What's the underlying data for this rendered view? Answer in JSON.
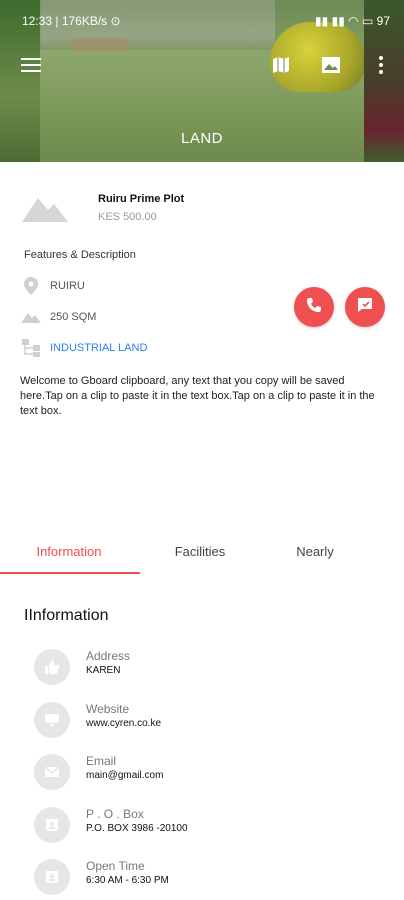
{
  "status_bar": {
    "time": "12:33 | 176KB/s ⊙",
    "system": "97"
  },
  "hero": {
    "title": "LAND"
  },
  "property": {
    "title": "Ruiru Prime Plot",
    "price": "KES 500.00"
  },
  "features": {
    "heading": "Features & Description",
    "items": [
      {
        "icon": "location-pin-icon",
        "text": "RUIRU"
      },
      {
        "icon": "area-icon",
        "text": "250 SQM"
      },
      {
        "icon": "category-icon",
        "text": "INDUSTRIAL LAND"
      }
    ]
  },
  "description": "Welcome to Gboard clipboard, any text that you copy will be saved here.Tap on a clip to paste it in the text box.Tap on a clip to paste it in the text box.",
  "actions": {
    "call_icon": "phone-icon",
    "message_icon": "message-icon",
    "accent_color": "#ef4f4f"
  },
  "tabs": [
    {
      "label": "Information",
      "active": true
    },
    {
      "label": "Facilities",
      "active": false
    },
    {
      "label": "Nearly",
      "active": false
    }
  ],
  "information": {
    "heading": "IInformation",
    "rows": [
      {
        "icon": "thumbs-up-icon",
        "label": "Address",
        "value": "KAREN"
      },
      {
        "icon": "monitor-icon",
        "label": "Website",
        "value": "www.cyren.co.ke"
      },
      {
        "icon": "mail-icon",
        "label": "Email",
        "value": "main@gmail.com"
      },
      {
        "icon": "box-icon",
        "label": "P . O . Box",
        "value": "P.O. BOX 3986 -20100"
      },
      {
        "icon": "clock-icon",
        "label": "Open Time",
        "value": "6:30 AM - 6:30 PM"
      }
    ]
  }
}
